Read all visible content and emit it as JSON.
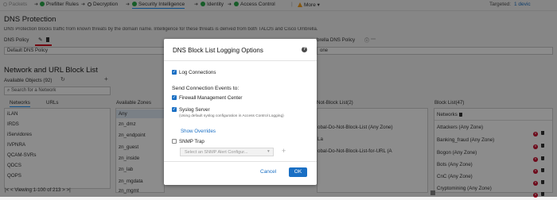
{
  "nav": {
    "items": [
      {
        "label": "Packets",
        "state": "faded"
      },
      {
        "label": "Prefilter Rules",
        "state": "check"
      },
      {
        "label": "Decryption",
        "state": "ring"
      },
      {
        "label": "Security Intelligence",
        "state": "check"
      },
      {
        "label": "Identity",
        "state": "check"
      },
      {
        "label": "Access Control",
        "state": "check"
      },
      {
        "label": "More",
        "state": "warn"
      }
    ],
    "targeted": "Targeted:",
    "targeted_count": "1 devic"
  },
  "dns": {
    "title": "DNS Protection",
    "desc": "DNS Protection blocks traffic from known threats by the domain name. Intelligence for these threats is derived from both TALOS and Cisco Umbrella.",
    "policy_label": "DNS Policy",
    "policy_value": "Default DNS Policy",
    "umbrella_label": "brella DNS Policy",
    "umbrella_value": "one"
  },
  "network": {
    "title": "Network and URL Block List",
    "available_label": "Available Objects (92)",
    "search_placeholder": "Search for a Network",
    "tabs": [
      "Networks",
      "URLs"
    ],
    "objects": [
      "iLAN",
      "IRDS",
      "iServidores",
      "IVPNRA",
      "QCAM-SVRs",
      "QDCS",
      "QOPS",
      "QOT"
    ],
    "viewing": "Viewing 1-100 of 213",
    "zones_label": "Available Zones",
    "zones": [
      "Any",
      "zn_dmz",
      "zn_endpoint",
      "zn_guest",
      "zn_inside",
      "zn_lab",
      "zn_mgdata",
      "zn_mgmt"
    ],
    "not_block_label": "Not-Block List(2)",
    "not_block": [
      "obal-Do-Not-Block-List (Any Zone)",
      "La",
      "obal-Do-Not-Block-List-for-URL (A"
    ],
    "block_label": "Block List(47)",
    "block_header": "Networks",
    "block": [
      "Attackers (Any Zone)",
      "Banking_fraud (Any Zone)",
      "Bogon (Any Zone)",
      "Bots (Any Zone)",
      "CnC (Any Zone)",
      "Cryptomining (Any Zone)"
    ]
  },
  "modal": {
    "title": "DNS Block List Logging Options",
    "log_connections": "Log Connections",
    "send_events": "Send Connection Events to:",
    "fmc": "Firewall Management Center",
    "syslog": "Syslog Server",
    "syslog_note": "(Using default syslog configuration in Access Control Logging)",
    "show_overrides": "Show Overrides",
    "snmp": "SNMP Trap",
    "snmp_placeholder": "Select an SNMP Alert Configur...",
    "cancel": "Cancel",
    "ok": "OK"
  }
}
